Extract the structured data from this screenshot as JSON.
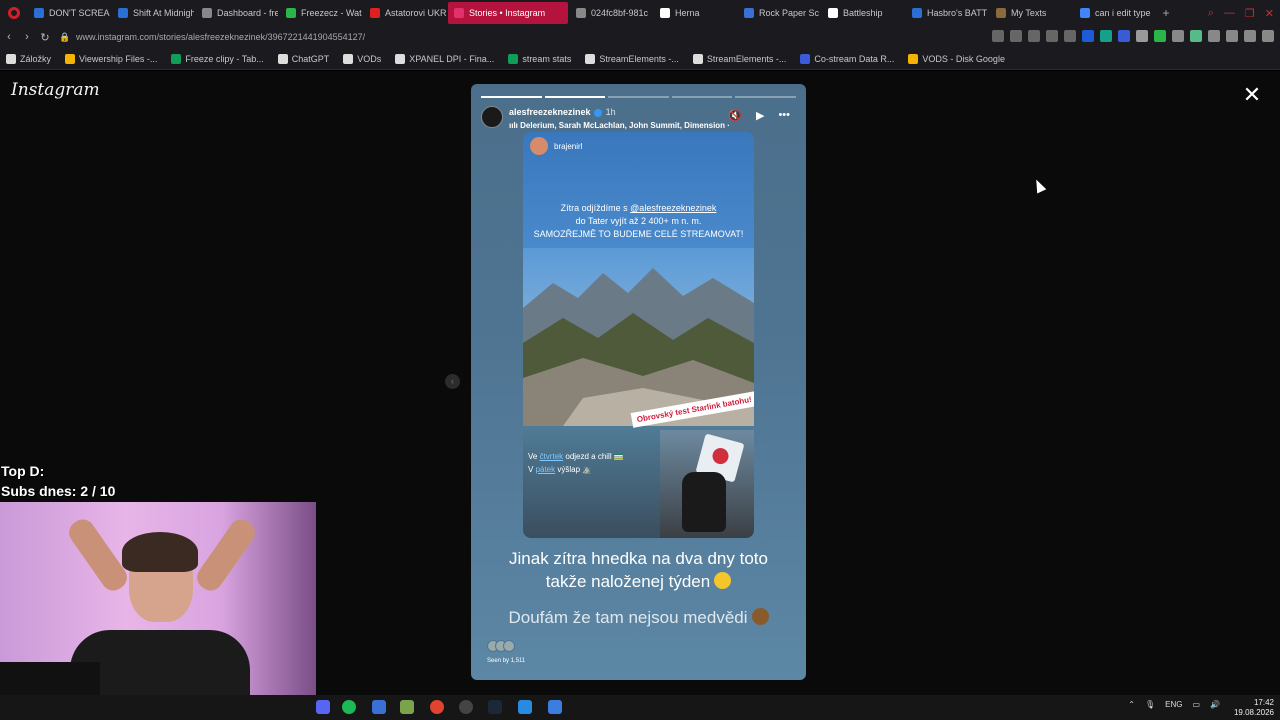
{
  "browser": {
    "tabs": [
      {
        "label": "DON'T SCREAM",
        "color": "#2a6fd6"
      },
      {
        "label": "Shift At Midnigh",
        "color": "#2a6fd6"
      },
      {
        "label": "Dashboard - fre",
        "color": "#888888"
      },
      {
        "label": "Freezecz - Wat",
        "color": "#2bb44a"
      },
      {
        "label": "Astatorovi UKR",
        "color": "#e02020"
      },
      {
        "label": "Stories • Instagram",
        "color": "#e1306c",
        "active": true
      },
      {
        "label": "024fc8bf-981c",
        "color": "#888888"
      },
      {
        "label": "Herna",
        "color": "#ffffff"
      },
      {
        "label": "Rock Paper Sc",
        "color": "#3b6fd6"
      },
      {
        "label": "Battleship",
        "color": "#ffffff"
      },
      {
        "label": "Hasbro's BATT",
        "color": "#2a6fd6"
      },
      {
        "label": "My Texts",
        "color": "#8a6a3a"
      },
      {
        "label": "can i edit type",
        "color": "#4285f4"
      }
    ],
    "url": "www.instagram.com/stories/alesfreezeknezinek/3967221441904554127/",
    "bookmarks": [
      {
        "label": "Záložky",
        "color": "#dddddd"
      },
      {
        "label": "Viewership Files -...",
        "color": "#f4b400"
      },
      {
        "label": "Freeze clipy - Tab...",
        "color": "#0f9d58"
      },
      {
        "label": "ChatGPT",
        "color": "#dddddd"
      },
      {
        "label": "VODs",
        "color": "#dddddd"
      },
      {
        "label": "XPANEL DPI - Fina...",
        "color": "#dddddd"
      },
      {
        "label": "stream stats",
        "color": "#0f9d58"
      },
      {
        "label": "StreamElements -...",
        "color": "#dddddd"
      },
      {
        "label": "StreamElements -...",
        "color": "#dddddd"
      },
      {
        "label": "Co-stream Data R...",
        "color": "#3b5bdb"
      },
      {
        "label": "VODS - Disk Google",
        "color": "#f4b400"
      }
    ]
  },
  "instagram": {
    "logo": "Instagram",
    "story": {
      "username": "alesfreezeknezinek",
      "time": "1h",
      "music": "Delerium, Sarah McLachlan, John Summit, Dimension ·",
      "inner_username": "brajenirl",
      "inner_line1": "Zítra odjíždíme s ",
      "inner_mention": "@alesfreezeknezinek",
      "inner_line2": "do Tater vyjít až 2 400+ m n. m.",
      "inner_line3": "SAMOZŘEJMĚ TO BUDEME CELÉ STREAMOVAT!",
      "sticker": "Obrovský test Starlink batohu!",
      "chill_prefix": "Ve ",
      "chill_day1": "čtvrtek",
      "chill_line1": " odjezd a chill 🚃",
      "chill_prefix2": "V ",
      "chill_day2": "pátek",
      "chill_line2": " výšlap ⛰️",
      "caption_line1": "Jinak zítra hnedka na dva dny toto",
      "caption_line2": "takže naloženej týden",
      "caption_line3": "Doufám že tam nejsou medvědi",
      "seen_by": "Seen by 1,511"
    }
  },
  "stream_overlay": {
    "line1": "Top D:",
    "line2": "Subs dnes: 2 / 10"
  },
  "taskbar": {
    "lang": "ENG",
    "time": "17:42",
    "date": "19.08.2026"
  }
}
